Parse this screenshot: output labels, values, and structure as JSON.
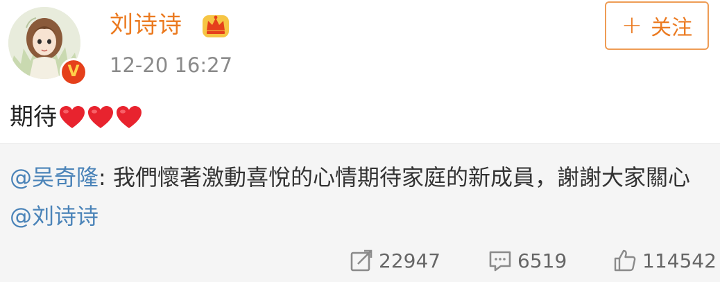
{
  "post": {
    "author": {
      "name": "刘诗诗",
      "verified_badge": "V",
      "crown_icon": "crown-icon"
    },
    "time": "12-20 16:27",
    "follow_label": "关注",
    "follow_icon": "plus-icon",
    "text": "期待",
    "hearts_count": 3,
    "heart_color": "#e8232e"
  },
  "repost": {
    "mention_author": "@吴奇隆",
    "colon": ":",
    "text": " 我們懷著激動喜悅的心情期待家庭的新成員，謝謝大家關心 ",
    "mention_tag": "@刘诗诗"
  },
  "stats": {
    "reposts": "22947",
    "comments": "6519",
    "likes": "114542"
  },
  "colors": {
    "accent": "#eb7a20",
    "link": "#4a83b8",
    "muted": "#8a8a8a",
    "repost_bg": "#f5f5f5"
  }
}
